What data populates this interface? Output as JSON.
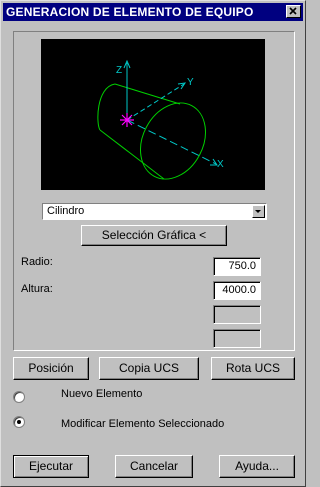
{
  "window": {
    "title": "GENERACION DE ELEMENTO DE EQUIPO"
  },
  "preview": {
    "axes": {
      "z": "Z",
      "y": "Y",
      "x": "X"
    },
    "colors": {
      "background": "#000000",
      "axis": "#00c8c8",
      "cylinder": "#00d000",
      "origin": "#ff00ff"
    }
  },
  "shape_select": {
    "value": "Cilindro"
  },
  "graphic_select_button": "Selección Gráfica <",
  "params": [
    {
      "label": "Radio:",
      "value": "750.0"
    },
    {
      "label": "Altura:",
      "value": "4000.0"
    },
    {
      "label": "",
      "value": ""
    },
    {
      "label": "",
      "value": ""
    }
  ],
  "buttons": {
    "position": "Posición",
    "copy_ucs": "Copia UCS",
    "rotate_ucs": "Rota UCS"
  },
  "mode": {
    "options": [
      {
        "label": "Nuevo Elemento",
        "selected": false
      },
      {
        "label": "Modificar Elemento Seleccionado",
        "selected": true
      }
    ]
  },
  "footer": {
    "execute": "Ejecutar",
    "cancel": "Cancelar",
    "help": "Ayuda..."
  }
}
